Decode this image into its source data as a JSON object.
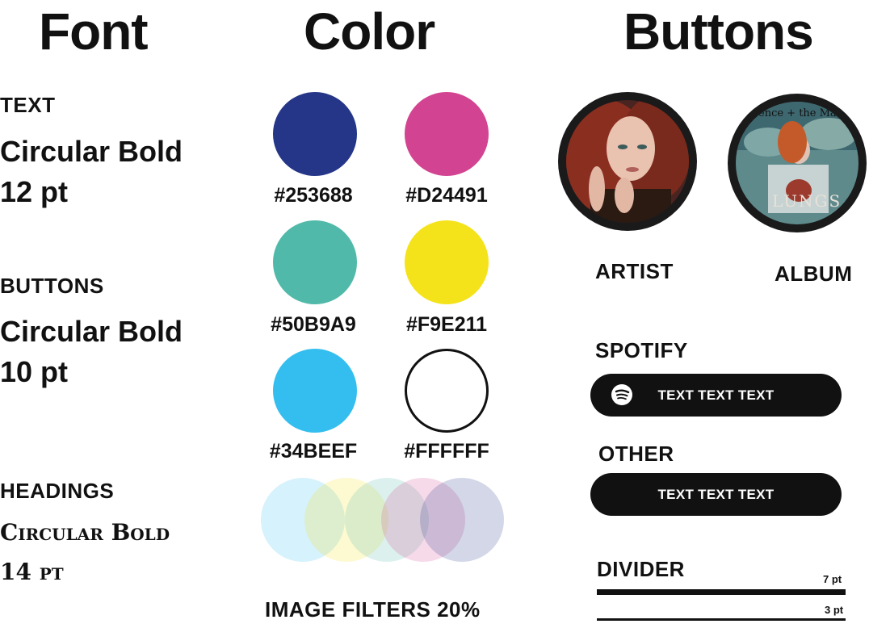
{
  "headings": {
    "font": "Font",
    "color": "Color",
    "buttons": "Buttons"
  },
  "font": {
    "text": {
      "label": "TEXT",
      "name": "Circular Bold",
      "size": "12 pt"
    },
    "buttons": {
      "label": "BUTTONS",
      "name": "Circular Bold",
      "size": "10 pt"
    },
    "headings": {
      "label": "HEADINGS",
      "name": "Circular Bold",
      "size": "14 pt"
    }
  },
  "colors": [
    {
      "hex": "#253688",
      "value": "#253688"
    },
    {
      "hex": "#D24491",
      "value": "#D24491"
    },
    {
      "hex": "#50B9A9",
      "value": "#50B9A9"
    },
    {
      "hex": "#F9E211",
      "value": "#F4E31B"
    },
    {
      "hex": "#34BEEF",
      "value": "#34BEEF"
    },
    {
      "hex": "#FFFFFF",
      "value": "#FFFFFF"
    }
  ],
  "image_filters": {
    "label": "IMAGE FILTERS 20%",
    "opacity": 0.2
  },
  "buttons": {
    "artist_label": "ARTIST",
    "album_label": "ALBUM",
    "album_cover_text": "LUNGS",
    "album_top_text": "ence + the Mac",
    "spotify_label": "SPOTIFY",
    "spotify_button_text": "TEXT TEXT TEXT",
    "other_label": "OTHER",
    "other_button_text": "TEXT TEXT TEXT",
    "divider_label": "DIVIDER",
    "divider_thick": "7 pt",
    "divider_thin": "3 pt"
  }
}
